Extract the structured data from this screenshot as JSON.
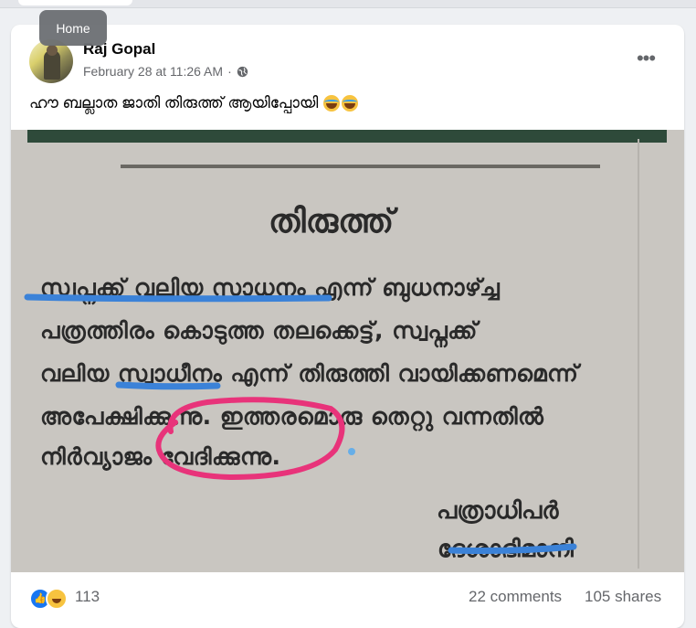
{
  "tooltip": {
    "label": "Home"
  },
  "post": {
    "author": "Raj Gopal",
    "date": "February 28 at 11:26 AM",
    "separator": "·",
    "audience_icon": "globe-icon",
    "more_icon": "•••",
    "caption": "ഹൗ ബല്ലാത ജാതി തിരുത്ത് ആയിപ്പോയി",
    "caption_emojis": [
      "laughing-emoji",
      "laughing-emoji"
    ]
  },
  "image": {
    "title": "തിരുത്ത്",
    "lines": [
      "സ്വപ്നക്ക് വലിയ സാധനം എന്ന് ബുധനാഴ്ച്ച",
      "പത്രത്തിരം കൊടുത്ത തലക്കെട്ട്, സ്വപ്നക്ക്",
      "വലിയ സ്വാധീനം എന്ന് തിരുത്തി വായിക്കണമെന്ന്",
      "അപേക്ഷിക്കുന്നു. ഇത്തരമൊരു തെറ്റു വന്നതിൽ",
      "നിർവ്യാജം വേദിക്കുന്നു."
    ],
    "signature_title": "പത്രാധിപർ",
    "signature_name": "ദേശാഭിമാനി"
  },
  "reactions": {
    "icons": [
      "like-icon",
      "haha-icon"
    ],
    "count": "113",
    "comments": "22 comments",
    "shares": "105 shares"
  },
  "colors": {
    "highlight_blue": "#3b82d8",
    "highlight_pink": "#e8337a",
    "link_gray": "#65676b"
  }
}
